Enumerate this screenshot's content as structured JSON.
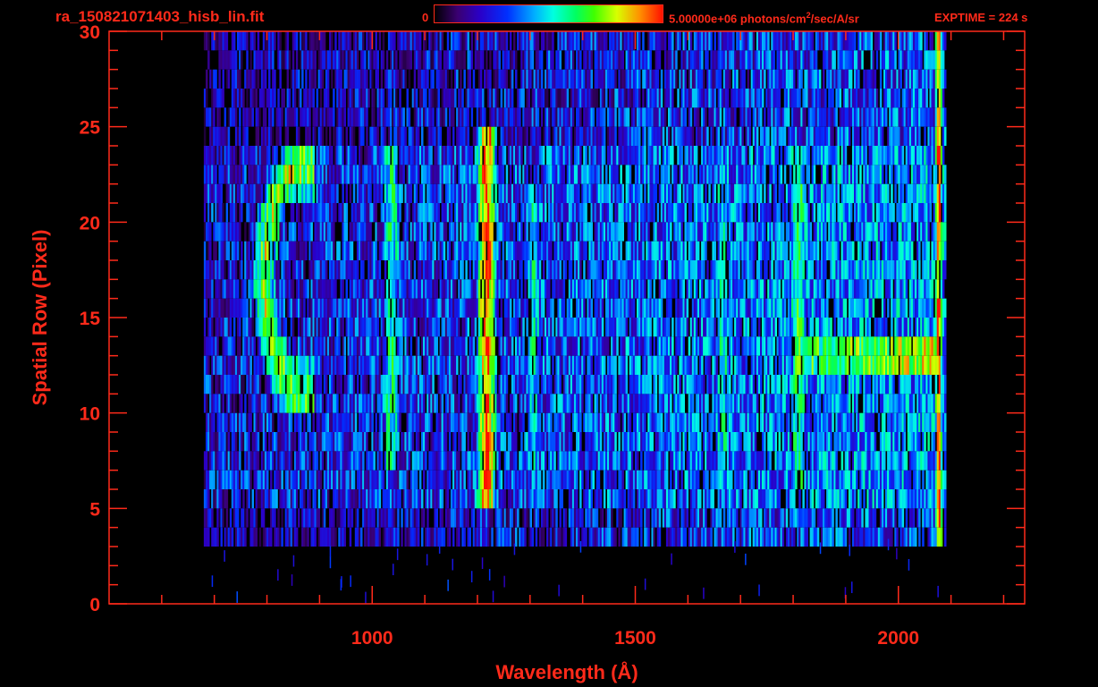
{
  "header": {
    "file_title": "ra_150821071403_hisb_lin.fit",
    "colorbar_min": "0",
    "colorbar_max_prefix": "5.00000e+06 photons/cm",
    "colorbar_max_sup": "2",
    "colorbar_max_suffix": "/sec/A/sr",
    "exptime": "EXPTIME = 224 s"
  },
  "chart_data": {
    "type": "heatmap",
    "title": "ra_150821071403_hisb_lin.fit",
    "xlabel": "Wavelength (Å)",
    "ylabel": "Spatial Row (Pixel)",
    "xlim": [
      500,
      2240
    ],
    "ylim": [
      0,
      30
    ],
    "x_ticks": [
      1000,
      1500,
      2000
    ],
    "y_ticks": [
      0,
      5,
      10,
      15,
      20,
      25,
      30
    ],
    "colorbar": {
      "min": 0,
      "max": 5000000,
      "units": "photons/cm^2/sec/A/sr",
      "colormap": [
        "#000000",
        "#3a0070",
        "#2a00c8",
        "#0030ff",
        "#00b0ff",
        "#00ffe0",
        "#00ff60",
        "#40ff00",
        "#d8ff00",
        "#ff9000",
        "#ff1000"
      ]
    },
    "data_extent": {
      "x": [
        680,
        2090
      ],
      "rows": [
        3,
        30
      ]
    },
    "features": [
      {
        "kind": "emission_line",
        "x": 1216,
        "rows": [
          5,
          25
        ],
        "level": 0.95
      },
      {
        "kind": "emission_line",
        "x": 1035,
        "rows": [
          7,
          24
        ],
        "level": 0.55
      },
      {
        "kind": "emission_line",
        "x": 1304,
        "rows": [
          7,
          22
        ],
        "level": 0.5
      },
      {
        "kind": "emission_line",
        "x": 1665,
        "rows": [
          8,
          22
        ],
        "level": 0.5
      },
      {
        "kind": "emission_line",
        "x": 1808,
        "rows": [
          6,
          24
        ],
        "level": 0.6
      },
      {
        "kind": "edge",
        "x": 2075,
        "rows": [
          2,
          30
        ],
        "level": 0.95
      },
      {
        "kind": "arc_structure",
        "x": [
          820,
          920
        ],
        "rows": [
          10,
          24
        ],
        "level": 0.75
      },
      {
        "kind": "band",
        "x": [
          1800,
          2075
        ],
        "rows": [
          12,
          14
        ],
        "level": 0.78
      }
    ]
  }
}
